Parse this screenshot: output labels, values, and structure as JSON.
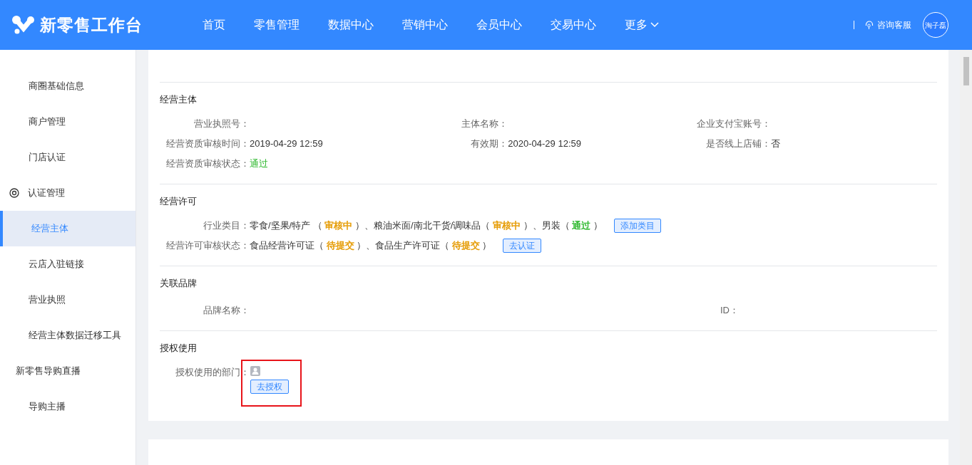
{
  "header": {
    "brand": "新零售工作台",
    "nav": [
      {
        "label": "首页",
        "kind": "link"
      },
      {
        "label": "零售管理",
        "kind": "link"
      },
      {
        "label": "数据中心",
        "kind": "link"
      },
      {
        "label": "营销中心",
        "kind": "link"
      },
      {
        "label": "会员中心",
        "kind": "link"
      },
      {
        "label": "交易中心",
        "kind": "link"
      },
      {
        "label": "更多",
        "kind": "dropdown"
      }
    ],
    "support": "咨询客服",
    "user": "淘子磊"
  },
  "sidebar": {
    "items": [
      {
        "label": "商圈基础信息",
        "kind": "item",
        "selected": false
      },
      {
        "label": "商户管理",
        "kind": "item",
        "selected": false
      },
      {
        "label": "门店认证",
        "kind": "item",
        "selected": false
      },
      {
        "label": "认证管理",
        "kind": "group",
        "selected": false
      },
      {
        "label": "经营主体",
        "kind": "item",
        "selected": true
      },
      {
        "label": "云店入驻链接",
        "kind": "item",
        "selected": false
      },
      {
        "label": "营业执照",
        "kind": "item",
        "selected": false
      },
      {
        "label": "经营主体数据迁移工具",
        "kind": "item",
        "selected": false
      },
      {
        "label": "新零售导购直播",
        "kind": "section",
        "selected": false
      },
      {
        "label": "导购主播",
        "kind": "item",
        "selected": false
      }
    ]
  },
  "sections": [
    {
      "title": "经营主体",
      "kind": "grid",
      "fields": [
        {
          "label": "营业执照号："
        },
        {
          "label": "主体名称："
        },
        {
          "label": "企业支付宝账号："
        },
        {
          "label": "经营资质审核时间：",
          "value": "2019-04-29 12:59"
        },
        {
          "label": "有效期：",
          "value": "2020-04-29 12:59"
        },
        {
          "label": "是否线上店铺：",
          "value": "否"
        },
        {
          "label": "经营资质审核状态：",
          "value": "通过",
          "color": "#2db82d"
        }
      ]
    },
    {
      "title": "经营许可",
      "kind": "rows",
      "rows": [
        {
          "label": "行业类目：",
          "segments": [
            {
              "text": "零食/坚果/特产 （ "
            },
            {
              "text": "审核中",
              "color": "#e59a00"
            },
            {
              "text": " ）、粮油米面/南北干货/调味品（ "
            },
            {
              "text": "审核中",
              "color": "#e59a00"
            },
            {
              "text": " ）、男装（ "
            },
            {
              "text": "通过",
              "color": "#2db82d"
            },
            {
              "text": " ）"
            }
          ],
          "button": "添加类目"
        },
        {
          "label": "经营许可审核状态：",
          "segments": [
            {
              "text": "食品经营许可证（ "
            },
            {
              "text": "待提交",
              "color": "#e59a00"
            },
            {
              "text": " ）、食品生产许可证（ "
            },
            {
              "text": "待提交",
              "color": "#e59a00"
            },
            {
              "text": " ）"
            }
          ],
          "button": "去认证"
        }
      ]
    },
    {
      "title": "关联品牌",
      "kind": "pair",
      "fields": [
        {
          "label": "品牌名称："
        },
        {
          "label": "ID："
        }
      ]
    },
    {
      "title": "授权使用",
      "kind": "auth",
      "label": "授权使用的部门：",
      "button": "去授权",
      "highlighted": true
    }
  ]
}
